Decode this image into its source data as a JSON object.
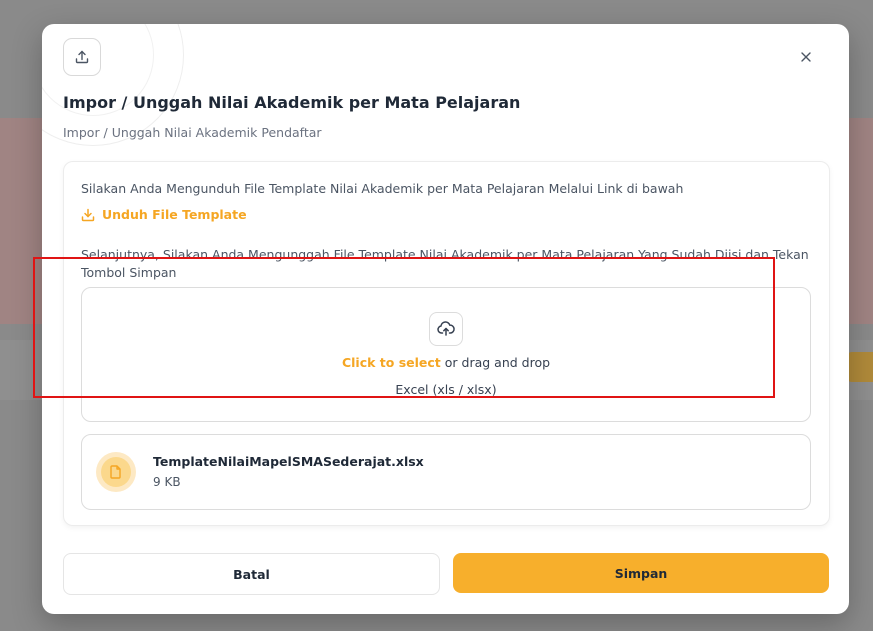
{
  "modal": {
    "title": "Impor / Unggah Nilai Akademik per Mata Pelajaran",
    "subtitle": "Impor / Unggah Nilai Akademik Pendaftar",
    "header_icon": "upload-icon",
    "close_icon": "close-icon"
  },
  "instructions": {
    "download_text": "Silakan Anda Mengunduh File Template Nilai Akademik per Mata Pelajaran Melalui Link di bawah",
    "download_link_label": "Unduh File Template",
    "download_icon": "download-icon",
    "upload_text": "Selanjutnya, Silakan Anda Mengunggah File Template Nilai Akademik per Mata Pelajaran Yang Sudah Diisi dan Tekan Tombol Simpan"
  },
  "dropzone": {
    "icon": "cloud-upload-icon",
    "select_label": "Click to select",
    "drag_label": " or drag and drop",
    "accepted": "Excel (xls / xlsx)"
  },
  "file": {
    "name": "TemplateNilaiMapelSMASederajat.xlsx",
    "size": "9 KB",
    "icon": "file-icon"
  },
  "buttons": {
    "cancel": "Batal",
    "save": "Simpan"
  },
  "colors": {
    "accent": "#f5a623",
    "primary_button": "#f7af2c",
    "highlight_border": "#e01414"
  }
}
